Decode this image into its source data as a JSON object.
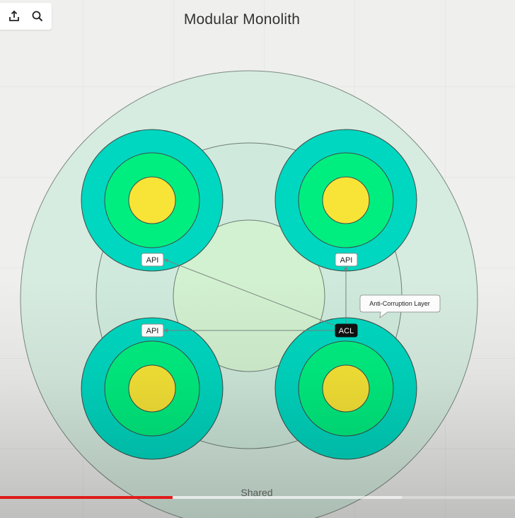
{
  "title": "Modular Monolith",
  "toolbar": {
    "share_icon": "share-upload-icon",
    "search_icon": "search-icon"
  },
  "labels": {
    "api": "API",
    "acl": "ACL",
    "anti_corruption_layer": "Anti-Corruption Layer",
    "shared": "Shared"
  },
  "colors": {
    "outer_ring": "#d7ece0",
    "middle_ring": "#cfeadc",
    "inner_ring": "#d2f1d0",
    "module_outer": "#00d7c0",
    "module_middle": "#00ee80",
    "module_core": "#f7e436",
    "acl_background": "#111111",
    "progress_played": "#e01b1b"
  },
  "video": {
    "played_fraction": 0.335,
    "buffered_fraction": 0.78
  }
}
